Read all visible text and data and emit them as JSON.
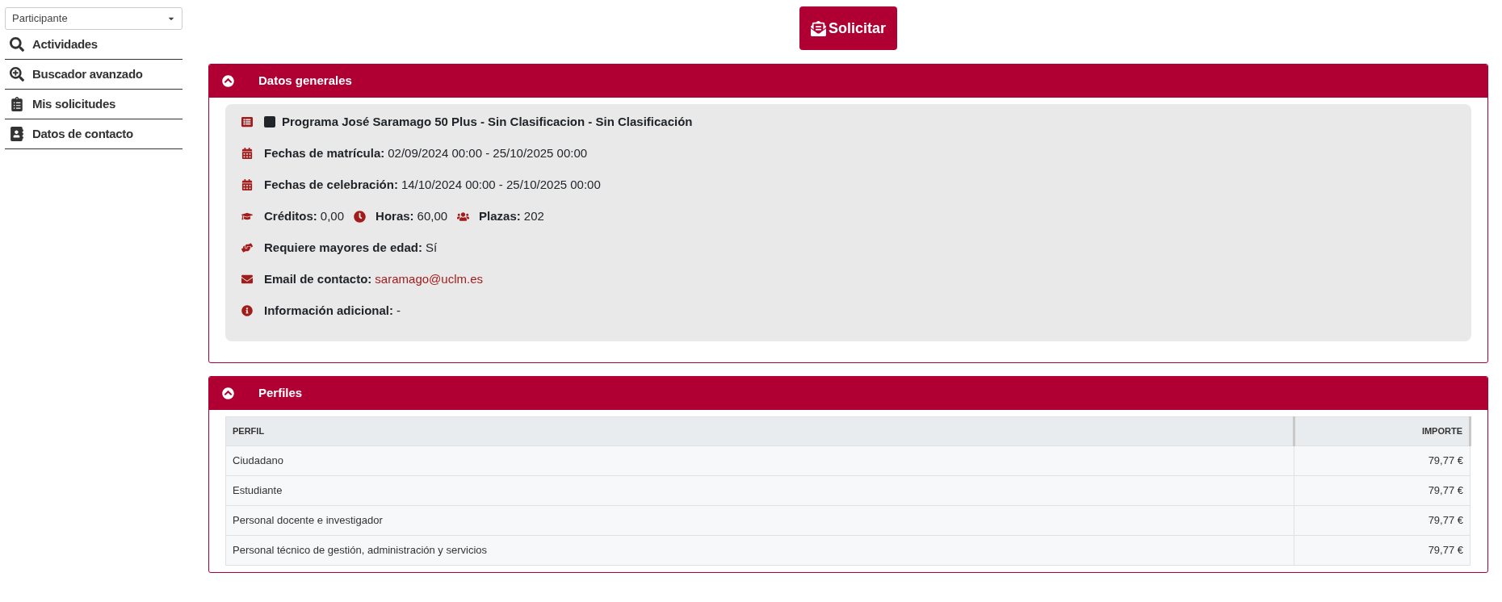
{
  "sidebar": {
    "role_select": {
      "value": "Participante"
    },
    "items": [
      {
        "label": "Actividades"
      },
      {
        "label": "Buscador avanzado"
      },
      {
        "label": "Mis solicitudes"
      },
      {
        "label": "Datos de contacto"
      }
    ]
  },
  "action_button": "Solicitar",
  "general_panel": {
    "title": "Datos generales",
    "expanded": true,
    "rows": [
      {
        "kind": "title",
        "color": "#212529",
        "text": "Programa José Saramago 50 Plus - Sin Clasificacion - Sin Clasificación"
      },
      {
        "kind": "fields",
        "parts": [
          {
            "label": "Fechas de matrícula:",
            "value": "02/09/2024 00:00 - 25/10/2025 00:00"
          }
        ]
      },
      {
        "kind": "fields",
        "parts": [
          {
            "label": "Fechas de celebración:",
            "value": "14/10/2024 00:00 - 25/10/2025 00:00"
          }
        ]
      },
      {
        "kind": "fields",
        "parts": [
          {
            "label": "Créditos:",
            "value": "0,00"
          },
          {
            "label": "Horas:",
            "value": "60,00"
          },
          {
            "label": "Plazas:",
            "value": "202"
          }
        ]
      },
      {
        "kind": "fields",
        "parts": [
          {
            "label": "Requiere mayores de edad:",
            "value": "Sí"
          }
        ]
      },
      {
        "kind": "fields",
        "parts": [
          {
            "label": "Email de contacto:",
            "value": "saramago@uclm.es",
            "link": true
          }
        ]
      },
      {
        "kind": "fields",
        "parts": [
          {
            "label": "Información adicional:",
            "value": "-"
          }
        ]
      }
    ]
  },
  "profiles_panel": {
    "title": "Perfiles",
    "expanded": true,
    "table": {
      "columns": [
        "PERFIL",
        "IMPORTE"
      ],
      "rows": [
        [
          "Ciudadano",
          "79,77 €"
        ],
        [
          "Estudiante",
          "79,77 €"
        ],
        [
          "Personal docente e investigador",
          "79,77 €"
        ],
        [
          "Personal técnico de gestión, administración y servicios",
          "79,77 €"
        ]
      ]
    }
  }
}
